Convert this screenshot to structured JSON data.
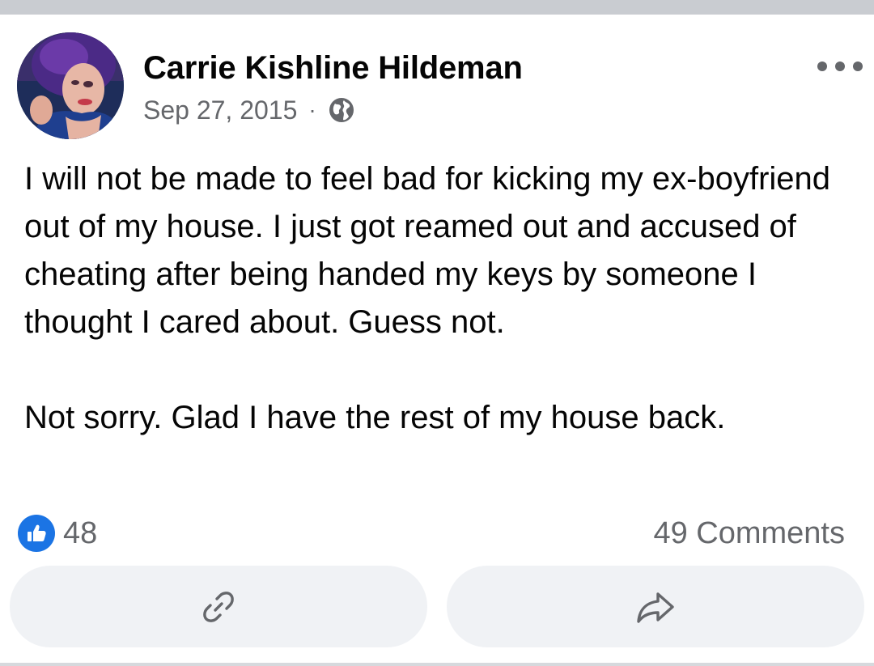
{
  "post": {
    "author_name": "Carrie Kishline Hildeman",
    "timestamp": "Sep 27, 2015",
    "separator": "·",
    "audience_icon": "globe-icon",
    "more_icon": "more-options-icon",
    "body_paragraph_1": "I will not be made to feel bad for kicking my ex-boyfriend out of my house. I just got reamed out and accused of cheating after being handed my keys by someone I thought I cared about. Guess not.",
    "body_paragraph_2": "Not sorry. Glad I have the rest of my house back."
  },
  "stats": {
    "reaction_icon": "like-icon",
    "reaction_count": "48",
    "comments_text": "49 Comments"
  },
  "actions": {
    "copy_link_icon": "link-icon",
    "share_icon": "share-arrow-icon"
  },
  "colors": {
    "like_blue": "#1b74e4",
    "secondary_text": "#65676b",
    "primary_text": "#050505",
    "button_bg": "#f0f2f5",
    "top_band": "#c9ccd1"
  }
}
